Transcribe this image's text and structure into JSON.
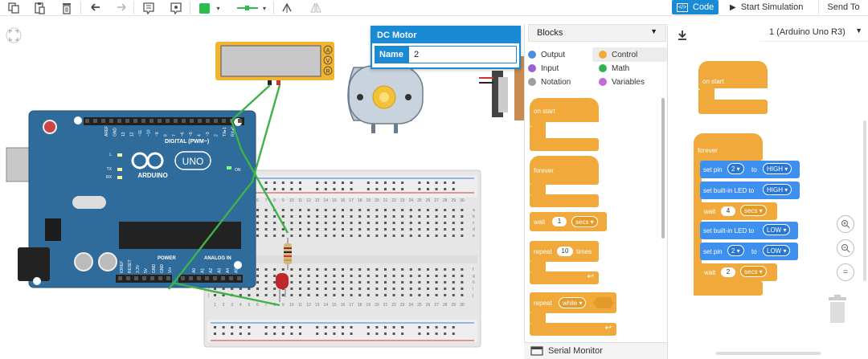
{
  "toolbar": {
    "icons": [
      "copy-icon",
      "paste-icon",
      "delete-icon",
      "undo-icon",
      "redo-icon",
      "note-icon",
      "notes-toggle-icon",
      "fill-color-icon",
      "line-style-icon",
      "rotate-icon",
      "flip-icon"
    ],
    "fill_color": "#2ebd4e",
    "line_color": "#2ebd4e",
    "code_label": "Code",
    "start_sim_label": "Start Simulation",
    "send_to_label": "Send To"
  },
  "canvas": {
    "lcd_buttons": [
      "A",
      "V",
      "R"
    ],
    "arduino": {
      "brand": "ARDUINO",
      "model": "UNO",
      "digital_label": "DIGITAL (PWM~)",
      "analog_label": "ANALOG IN",
      "power_label": "POWER",
      "pin_labels_top": [
        "AREF",
        "GND",
        "13",
        "12",
        "~11",
        "~10",
        "~9",
        "8",
        "7",
        "~6",
        "~5",
        "4",
        "~3",
        "2",
        "TX▸1",
        "RX◂0"
      ],
      "pin_labels_power": [
        "IOREF",
        "RESET",
        "3.3V",
        "5V",
        "GND",
        "GND",
        "Vin"
      ],
      "pin_labels_analog": [
        "A0",
        "A1",
        "A2",
        "A3",
        "A4",
        "A5"
      ],
      "led_labels": [
        "L",
        "TX",
        "RX",
        "ON"
      ]
    },
    "breadboard_rows": [
      "a",
      "b",
      "c",
      "d",
      "e",
      "f",
      "g",
      "h",
      "i",
      "j"
    ],
    "breadboard_cols": [
      "1",
      "2",
      "3",
      "4",
      "5",
      "6",
      "7",
      "8",
      "9",
      "10",
      "11",
      "12",
      "13",
      "14",
      "15",
      "16",
      "17",
      "18",
      "19",
      "20",
      "21",
      "22",
      "23",
      "24",
      "25",
      "26",
      "27",
      "28",
      "29",
      "30"
    ],
    "wire_color": "#3db34a"
  },
  "motor_panel": {
    "title": "DC Motor",
    "name_label": "Name",
    "name_value": "2"
  },
  "blocks_panel": {
    "dropdown_label": "Blocks",
    "categories": [
      {
        "label": "Output",
        "color": "#4a90e2"
      },
      {
        "label": "Control",
        "color": "#f2a93b"
      },
      {
        "label": "Input",
        "color": "#9b5fd0"
      },
      {
        "label": "Math",
        "color": "#34b356"
      },
      {
        "label": "Notation",
        "color": "#9e9e9e"
      },
      {
        "label": "Variables",
        "color": "#c56bd8"
      }
    ],
    "palette": {
      "on_start": "on start",
      "forever": "forever",
      "wait_label": "wait",
      "wait_value": "1",
      "wait_unit": "secs",
      "repeat_label": "repeat",
      "repeat_value": "10",
      "repeat_unit": "times",
      "repeat_while_label": "repeat",
      "repeat_while_mode": "while"
    }
  },
  "workspace": {
    "board_select": "1 (Arduino Uno R3)",
    "on_start": "on start",
    "forever": "forever",
    "program": [
      {
        "label": "set pin",
        "pin": "2",
        "to": "to",
        "value": "HIGH"
      },
      {
        "label": "set built-in LED to",
        "value": "HIGH"
      },
      {
        "label": "wait",
        "value": "4",
        "unit": "secs"
      },
      {
        "label": "set built-in LED to",
        "value": "LOW"
      },
      {
        "label": "set pin",
        "pin": "2",
        "to": "to",
        "value": "LOW"
      },
      {
        "label": "wait",
        "value": "2",
        "unit": "secs"
      }
    ],
    "zoom_icons": [
      "zoom-in-icon",
      "zoom-out-icon",
      "zoom-fit-icon"
    ]
  },
  "serial_monitor": {
    "label": "Serial Monitor"
  }
}
